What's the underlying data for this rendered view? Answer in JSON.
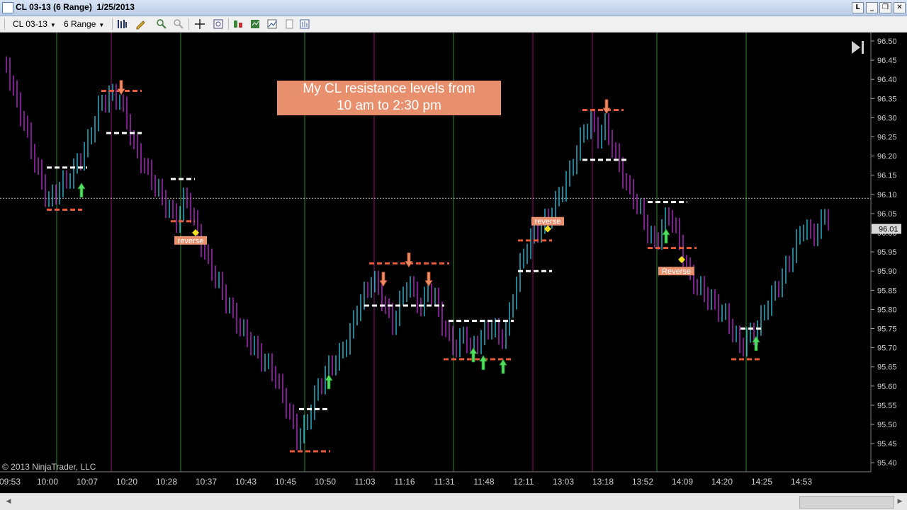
{
  "window": {
    "title": "CL 03-13 (6 Range)  1/25/2013",
    "buttons": [
      "L",
      "_",
      "❐",
      "✕"
    ]
  },
  "toolbar": {
    "instrument": "CL 03-13",
    "interval": "6 Range"
  },
  "chart_data": {
    "type": "ohlc-range-bars",
    "instrument": "CL 03-13",
    "interval": "6 Range",
    "date": "1/25/2013",
    "annotation": "My CL resistance levels from\n10 am to 2:30 pm",
    "copyright": "© 2013 NinjaTrader, LLC",
    "current_price": "96.01",
    "reference_line": 96.09,
    "y_range": [
      95.38,
      96.52
    ],
    "y_ticks": [
      "96.50",
      "96.45",
      "96.40",
      "96.35",
      "96.30",
      "96.25",
      "96.20",
      "96.15",
      "96.10",
      "96.05",
      "96.00",
      "95.95",
      "95.90",
      "95.85",
      "95.80",
      "95.75",
      "95.70",
      "95.65",
      "95.60",
      "95.55",
      "95.50",
      "95.45",
      "95.40"
    ],
    "x_labels": [
      "09:53",
      "10:00",
      "10:07",
      "10:20",
      "10:28",
      "10:37",
      "10:43",
      "10:45",
      "10:50",
      "11:03",
      "11:16",
      "11:31",
      "11:48",
      "12:11",
      "13:03",
      "13:18",
      "13:52",
      "14:09",
      "14:20",
      "14:25",
      "14:53"
    ],
    "price_path": [
      [
        9,
        96.44
      ],
      [
        20,
        96.36
      ],
      [
        35,
        96.28
      ],
      [
        50,
        96.18
      ],
      [
        68,
        96.08
      ],
      [
        85,
        96.12
      ],
      [
        100,
        96.15
      ],
      [
        115,
        96.2
      ],
      [
        125,
        96.24
      ],
      [
        140,
        96.33
      ],
      [
        155,
        96.36
      ],
      [
        168,
        96.35
      ],
      [
        178,
        96.3
      ],
      [
        190,
        96.22
      ],
      [
        205,
        96.17
      ],
      [
        220,
        96.12
      ],
      [
        235,
        96.07
      ],
      [
        250,
        96.03
      ],
      [
        262,
        96.1
      ],
      [
        272,
        96.04
      ],
      [
        280,
        95.99
      ],
      [
        295,
        95.92
      ],
      [
        310,
        95.86
      ],
      [
        325,
        95.8
      ],
      [
        340,
        95.75
      ],
      [
        355,
        95.71
      ],
      [
        370,
        95.67
      ],
      [
        385,
        95.64
      ],
      [
        400,
        95.57
      ],
      [
        412,
        95.51
      ],
      [
        420,
        95.46
      ],
      [
        432,
        95.5
      ],
      [
        440,
        95.55
      ],
      [
        450,
        95.6
      ],
      [
        465,
        95.65
      ],
      [
        480,
        95.68
      ],
      [
        495,
        95.74
      ],
      [
        505,
        95.81
      ],
      [
        515,
        95.84
      ],
      [
        525,
        95.88
      ],
      [
        535,
        95.85
      ],
      [
        545,
        95.8
      ],
      [
        555,
        95.76
      ],
      [
        565,
        95.82
      ],
      [
        575,
        95.87
      ],
      [
        585,
        95.84
      ],
      [
        595,
        95.8
      ],
      [
        605,
        95.86
      ],
      [
        615,
        95.82
      ],
      [
        625,
        95.76
      ],
      [
        635,
        95.72
      ],
      [
        645,
        95.7
      ],
      [
        655,
        95.74
      ],
      [
        665,
        95.69
      ],
      [
        675,
        95.72
      ],
      [
        685,
        95.74
      ],
      [
        695,
        95.76
      ],
      [
        705,
        95.72
      ],
      [
        715,
        95.75
      ],
      [
        725,
        95.84
      ],
      [
        735,
        95.92
      ],
      [
        745,
        95.97
      ],
      [
        755,
        96.0
      ],
      [
        765,
        96.02
      ],
      [
        775,
        96.04
      ],
      [
        785,
        96.08
      ],
      [
        795,
        96.12
      ],
      [
        805,
        96.16
      ],
      [
        815,
        96.22
      ],
      [
        825,
        96.27
      ],
      [
        835,
        96.29
      ],
      [
        845,
        96.25
      ],
      [
        855,
        96.28
      ],
      [
        865,
        96.22
      ],
      [
        875,
        96.17
      ],
      [
        885,
        96.12
      ],
      [
        895,
        96.09
      ],
      [
        905,
        96.05
      ],
      [
        915,
        96.0
      ],
      [
        925,
        95.97
      ],
      [
        935,
        96.02
      ],
      [
        945,
        96.05
      ],
      [
        955,
        96.0
      ],
      [
        965,
        95.93
      ],
      [
        975,
        95.88
      ],
      [
        985,
        95.86
      ],
      [
        995,
        95.84
      ],
      [
        1005,
        95.82
      ],
      [
        1015,
        95.8
      ],
      [
        1025,
        95.78
      ],
      [
        1035,
        95.74
      ],
      [
        1045,
        95.7
      ],
      [
        1055,
        95.73
      ],
      [
        1065,
        95.74
      ],
      [
        1075,
        95.78
      ],
      [
        1085,
        95.82
      ],
      [
        1095,
        95.85
      ],
      [
        1105,
        95.89
      ],
      [
        1115,
        95.93
      ],
      [
        1125,
        95.98
      ],
      [
        1135,
        96.02
      ],
      [
        1145,
        95.99
      ],
      [
        1155,
        96.01
      ],
      [
        1165,
        96.05
      ],
      [
        1172,
        96.03
      ]
    ],
    "session_lines": [
      {
        "x": 80,
        "color": "green"
      },
      {
        "x": 157,
        "color": "magenta"
      },
      {
        "x": 255,
        "color": "green"
      },
      {
        "x": 430,
        "color": "green"
      },
      {
        "x": 528,
        "color": "magenta"
      },
      {
        "x": 640,
        "color": "green"
      },
      {
        "x": 752,
        "color": "magenta"
      },
      {
        "x": 836,
        "color": "magenta"
      },
      {
        "x": 927,
        "color": "green"
      },
      {
        "x": 1053,
        "color": "green"
      }
    ],
    "levels": [
      {
        "x1": 143,
        "x2": 200,
        "y": 96.37,
        "kind": "red"
      },
      {
        "x1": 150,
        "x2": 200,
        "y": 96.26,
        "kind": "white"
      },
      {
        "x1": 66,
        "x2": 123,
        "y": 96.17,
        "kind": "white"
      },
      {
        "x1": 66,
        "x2": 116,
        "y": 96.06,
        "kind": "red"
      },
      {
        "x1": 241,
        "x2": 275,
        "y": 96.14,
        "kind": "white"
      },
      {
        "x1": 241,
        "x2": 275,
        "y": 96.03,
        "kind": "red"
      },
      {
        "x1": 422,
        "x2": 466,
        "y": 95.54,
        "kind": "white"
      },
      {
        "x1": 409,
        "x2": 466,
        "y": 95.43,
        "kind": "red"
      },
      {
        "x1": 521,
        "x2": 634,
        "y": 95.92,
        "kind": "red"
      },
      {
        "x1": 514,
        "x2": 627,
        "y": 95.81,
        "kind": "white"
      },
      {
        "x1": 633,
        "x2": 725,
        "y": 95.77,
        "kind": "white"
      },
      {
        "x1": 626,
        "x2": 725,
        "y": 95.67,
        "kind": "red"
      },
      {
        "x1": 731,
        "x2": 779,
        "y": 95.98,
        "kind": "red"
      },
      {
        "x1": 731,
        "x2": 779,
        "y": 95.9,
        "kind": "white"
      },
      {
        "x1": 822,
        "x2": 880,
        "y": 96.32,
        "kind": "red"
      },
      {
        "x1": 822,
        "x2": 885,
        "y": 96.19,
        "kind": "white"
      },
      {
        "x1": 914,
        "x2": 970,
        "y": 96.08,
        "kind": "white"
      },
      {
        "x1": 914,
        "x2": 983,
        "y": 95.96,
        "kind": "red"
      },
      {
        "x1": 1045,
        "x2": 1076,
        "y": 95.75,
        "kind": "white"
      },
      {
        "x1": 1032,
        "x2": 1076,
        "y": 95.67,
        "kind": "red"
      }
    ],
    "arrows_up": [
      {
        "x": 115,
        "y": 96.1
      },
      {
        "x": 464,
        "y": 95.6
      },
      {
        "x": 668,
        "y": 95.67
      },
      {
        "x": 682,
        "y": 95.65
      },
      {
        "x": 710,
        "y": 95.64
      },
      {
        "x": 940,
        "y": 95.98
      },
      {
        "x": 1067,
        "y": 95.7
      }
    ],
    "arrows_down": [
      {
        "x": 171,
        "y": 96.39,
        "c": "salmon"
      },
      {
        "x": 541,
        "y": 95.89,
        "c": "salmon"
      },
      {
        "x": 577,
        "y": 95.94,
        "c": "salmon"
      },
      {
        "x": 605,
        "y": 95.89,
        "c": "salmon"
      },
      {
        "x": 856,
        "y": 96.34,
        "c": "salmon"
      }
    ],
    "diamonds": [
      {
        "x": 276,
        "y": 96.0
      },
      {
        "x": 773,
        "y": 96.01
      },
      {
        "x": 962,
        "y": 95.93
      }
    ],
    "labels": [
      {
        "x": 246,
        "y": 95.98,
        "text": "reverse",
        "w": 46
      },
      {
        "x": 750,
        "y": 96.03,
        "text": "reverse",
        "w": 46
      },
      {
        "x": 929,
        "y": 95.9,
        "text": "Reverse",
        "w": 51
      }
    ]
  }
}
